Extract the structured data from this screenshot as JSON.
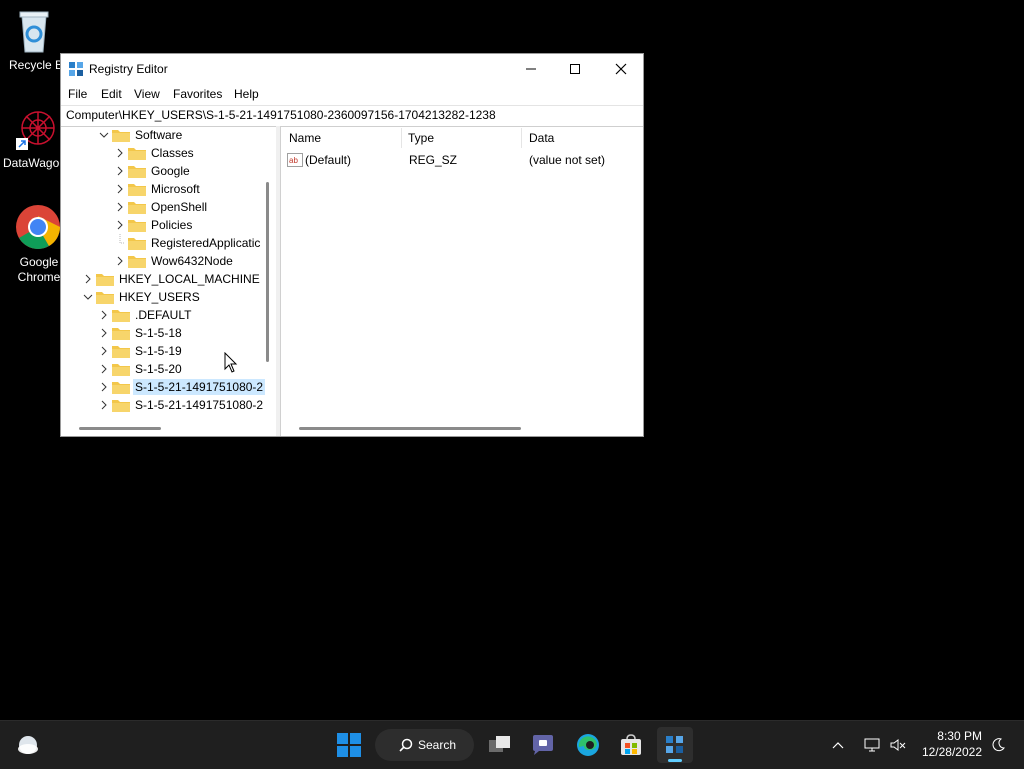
{
  "desktop": {
    "icons": [
      {
        "label": "Recycle Bi"
      },
      {
        "label": "DataWago"
      },
      {
        "label": "Google Chrome"
      }
    ]
  },
  "window": {
    "title": "Registry Editor",
    "menu": [
      "File",
      "Edit",
      "View",
      "Favorites",
      "Help"
    ],
    "address": "Computer\\HKEY_USERS\\S-1-5-21-1491751080-2360097156-1704213282-1238",
    "tree": [
      {
        "label": "Software",
        "state": "expanded"
      },
      {
        "label": "Classes",
        "state": "collapsed"
      },
      {
        "label": "Google",
        "state": "collapsed"
      },
      {
        "label": "Microsoft",
        "state": "collapsed"
      },
      {
        "label": "OpenShell",
        "state": "collapsed"
      },
      {
        "label": "Policies",
        "state": "collapsed"
      },
      {
        "label": "RegisteredApplicatic",
        "state": "leaf"
      },
      {
        "label": "Wow6432Node",
        "state": "collapsed"
      },
      {
        "label": "HKEY_LOCAL_MACHINE",
        "state": "collapsed"
      },
      {
        "label": "HKEY_USERS",
        "state": "expanded"
      },
      {
        "label": ".DEFAULT",
        "state": "collapsed"
      },
      {
        "label": "S-1-5-18",
        "state": "collapsed"
      },
      {
        "label": "S-1-5-19",
        "state": "collapsed"
      },
      {
        "label": "S-1-5-20",
        "state": "collapsed"
      },
      {
        "label": "S-1-5-21-1491751080-2",
        "state": "collapsed",
        "selected": true
      },
      {
        "label": "S-1-5-21-1491751080-2",
        "state": "collapsed"
      }
    ],
    "columns": [
      "Name",
      "Type",
      "Data"
    ],
    "values": [
      {
        "name": "(Default)",
        "type": "REG_SZ",
        "data": "(value not set)"
      }
    ]
  },
  "taskbar": {
    "search_label": "Search",
    "time": "8:30 PM",
    "date": "12/28/2022"
  },
  "colors": {
    "selection": "#cce8ff",
    "folder": "#f3c74a",
    "taskbar_bg": "#1f1f1f",
    "start_blue": "#1e8fe6"
  }
}
